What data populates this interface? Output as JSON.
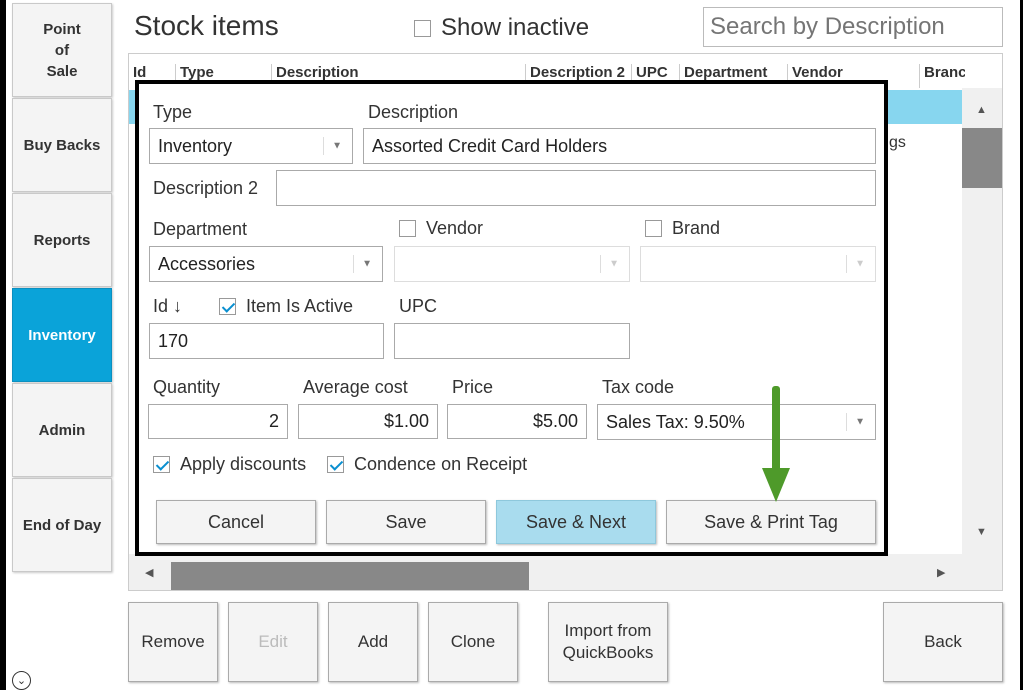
{
  "sidebar": {
    "items": [
      {
        "label": "Point of Sale",
        "lines": [
          "Point",
          "of",
          "Sale"
        ]
      },
      {
        "label": "Buy Backs"
      },
      {
        "label": "Reports"
      },
      {
        "label": "Inventory"
      },
      {
        "label": "Admin"
      },
      {
        "label": "End of Day"
      }
    ],
    "collapse_glyph": "⌄"
  },
  "header": {
    "title": "Stock items",
    "show_inactive_label": "Show inactive",
    "search_placeholder": "Search by Description"
  },
  "table": {
    "columns": [
      "Id",
      "Type",
      "Description",
      "Description 2",
      "UPC",
      "Department",
      "Vendor",
      "Branc"
    ],
    "visible_fragment": "gs"
  },
  "dialog": {
    "type_label": "Type",
    "type_value": "Inventory",
    "description_label": "Description",
    "description_value": "Assorted Credit Card Holders",
    "description2_label": "Description 2",
    "description2_value": "",
    "department_label": "Department",
    "department_value": "Accessories",
    "vendor_label": "Vendor",
    "brand_label": "Brand",
    "id_label": "Id ↓",
    "item_active_label": "Item Is Active",
    "upc_label": "UPC",
    "id_value": "170",
    "upc_value": "",
    "quantity_label": "Quantity",
    "quantity_value": "2",
    "avg_cost_label": "Average cost",
    "avg_cost_value": "$1.00",
    "price_label": "Price",
    "price_value": "$5.00",
    "tax_label": "Tax code",
    "tax_value": "Sales Tax: 9.50%",
    "apply_discounts_label": "Apply discounts",
    "condence_label": "Condence on Receipt",
    "cancel_label": "Cancel",
    "save_label": "Save",
    "save_next_label": "Save & Next",
    "save_print_label": "Save & Print Tag"
  },
  "bottom_bar": {
    "remove_label": "Remove",
    "edit_label": "Edit",
    "add_label": "Add",
    "clone_label": "Clone",
    "import_lines": [
      "Import from",
      "QuickBooks"
    ],
    "back_label": "Back"
  },
  "colors": {
    "accent": "#0aa3d9",
    "selected_row": "#87d6ef",
    "primary_button": "#a9dcee",
    "annotation_arrow": "#4e9a2a"
  },
  "icons": {
    "dropdown": "chevron-down-icon",
    "scroll_up": "triangle-up-icon",
    "scroll_down": "triangle-down-icon",
    "scroll_left": "triangle-left-icon",
    "scroll_right": "triangle-right-icon",
    "annotation": "green-down-arrow"
  }
}
